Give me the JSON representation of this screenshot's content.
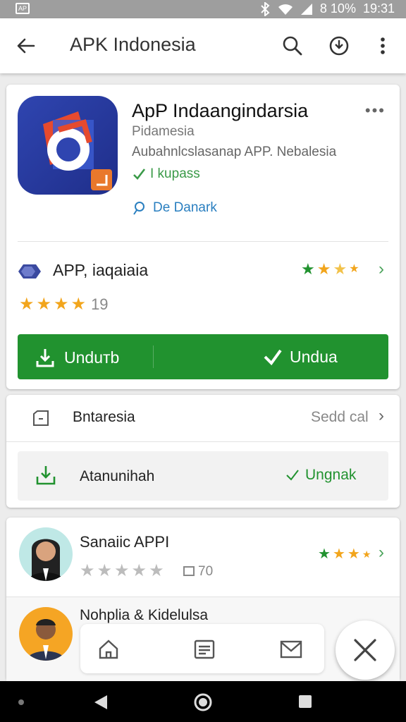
{
  "status": {
    "battery": "8 10%",
    "time": "19:31"
  },
  "appbar": {
    "title": "APK Indonesia"
  },
  "app": {
    "name": "ApP Indaangindarsia",
    "developer": "Pidamesia",
    "description": "Aubahnlcslasanap APP. Nebalesia",
    "badge": "I kupass",
    "link": "De  Danark",
    "more": "•••"
  },
  "rating_row": {
    "title": "APP, iaqaiaia",
    "stars_count": "19",
    "small_stars": "★★★★"
  },
  "buttons": {
    "download": "Unduтb",
    "install": "Undua"
  },
  "info": {
    "row1_label": "Bntaresia",
    "row1_value": "Sedd cal",
    "row2_label": "Atanunihah",
    "row2_action": "Ungnak"
  },
  "reviews": [
    {
      "name": "Sanaiic APPI",
      "count": "70"
    },
    {
      "name": "Nohplia & Kidelulsa"
    }
  ],
  "colors": {
    "green": "#21922f",
    "star": "#f2a51c",
    "link": "#2a7fc0"
  }
}
